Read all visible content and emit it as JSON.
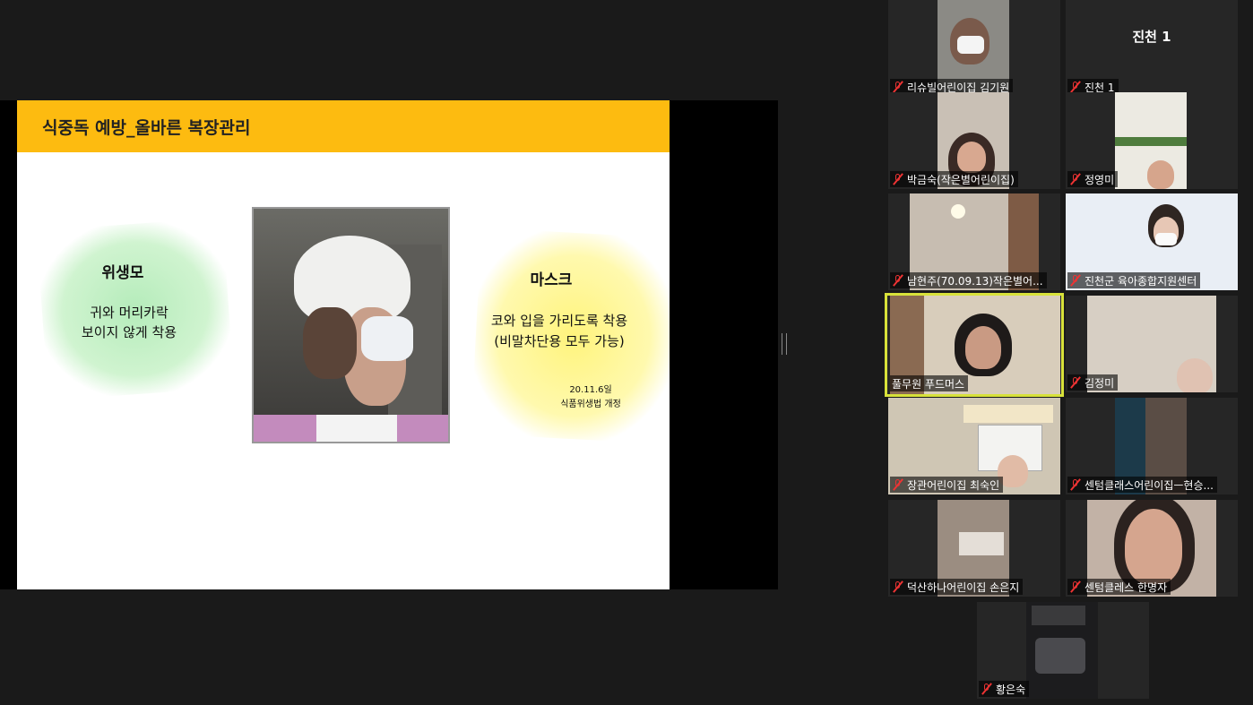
{
  "slide": {
    "title": "식중독 예방_올바른 복장관리",
    "hat": {
      "label": "위생모",
      "desc_line1": "귀와 머리카락",
      "desc_line2": "보이지 않게 착용"
    },
    "mask": {
      "label": "마스크",
      "desc_line1": "코와 입을 가리도록 착용",
      "desc_line2": "(비말차단용 모두 가능)",
      "note_date": "20.11.6일",
      "note_law": "식품위생법 개정"
    }
  },
  "participants": [
    {
      "name": "리슈빌어린이집 김기원",
      "muted": true
    },
    {
      "name": "진천 1",
      "muted": true,
      "center_label": "진천 1"
    },
    {
      "name": "박금숙(작은별어린이집)",
      "muted": true
    },
    {
      "name": "정영미",
      "muted": true
    },
    {
      "name": "남현주(70.09.13)작은별어...",
      "muted": true
    },
    {
      "name": "진천군 육아종합지원센터",
      "muted": true
    },
    {
      "name": "풀무원 푸드머스",
      "muted": false,
      "active_speaker": true
    },
    {
      "name": "김정미",
      "muted": true
    },
    {
      "name": "장관어린이집 최숙인",
      "muted": true
    },
    {
      "name": "센텀클래스어린이집ㅡ현승...",
      "muted": true
    },
    {
      "name": "덕산하나어린이집 손은지",
      "muted": true
    },
    {
      "name": "센텀클레스 한명자",
      "muted": true
    },
    {
      "name": "황은숙",
      "muted": true
    }
  ],
  "colors": {
    "header_yellow": "#fdbb10",
    "active_border": "#d8e23a",
    "muted_red": "#e33333",
    "background": "#1a1a1a"
  }
}
